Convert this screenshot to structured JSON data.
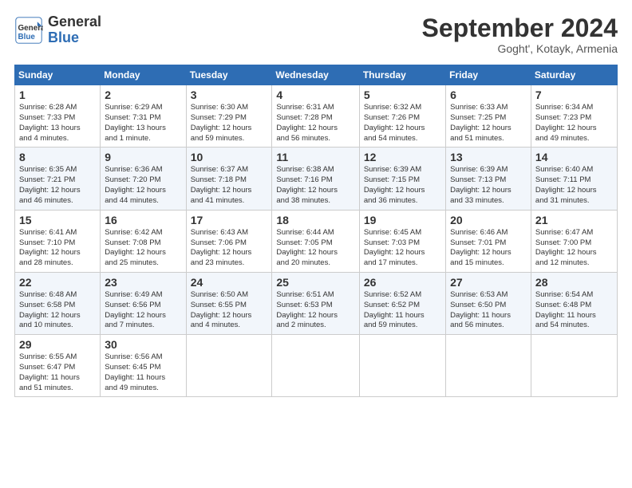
{
  "header": {
    "logo_general": "General",
    "logo_blue": "Blue",
    "month_title": "September 2024",
    "subtitle": "Goght', Kotayk, Armenia"
  },
  "columns": [
    "Sunday",
    "Monday",
    "Tuesday",
    "Wednesday",
    "Thursday",
    "Friday",
    "Saturday"
  ],
  "weeks": [
    [
      {
        "day": "1",
        "info": "Sunrise: 6:28 AM\nSunset: 7:33 PM\nDaylight: 13 hours\nand 4 minutes."
      },
      {
        "day": "2",
        "info": "Sunrise: 6:29 AM\nSunset: 7:31 PM\nDaylight: 13 hours\nand 1 minute."
      },
      {
        "day": "3",
        "info": "Sunrise: 6:30 AM\nSunset: 7:29 PM\nDaylight: 12 hours\nand 59 minutes."
      },
      {
        "day": "4",
        "info": "Sunrise: 6:31 AM\nSunset: 7:28 PM\nDaylight: 12 hours\nand 56 minutes."
      },
      {
        "day": "5",
        "info": "Sunrise: 6:32 AM\nSunset: 7:26 PM\nDaylight: 12 hours\nand 54 minutes."
      },
      {
        "day": "6",
        "info": "Sunrise: 6:33 AM\nSunset: 7:25 PM\nDaylight: 12 hours\nand 51 minutes."
      },
      {
        "day": "7",
        "info": "Sunrise: 6:34 AM\nSunset: 7:23 PM\nDaylight: 12 hours\nand 49 minutes."
      }
    ],
    [
      {
        "day": "8",
        "info": "Sunrise: 6:35 AM\nSunset: 7:21 PM\nDaylight: 12 hours\nand 46 minutes."
      },
      {
        "day": "9",
        "info": "Sunrise: 6:36 AM\nSunset: 7:20 PM\nDaylight: 12 hours\nand 44 minutes."
      },
      {
        "day": "10",
        "info": "Sunrise: 6:37 AM\nSunset: 7:18 PM\nDaylight: 12 hours\nand 41 minutes."
      },
      {
        "day": "11",
        "info": "Sunrise: 6:38 AM\nSunset: 7:16 PM\nDaylight: 12 hours\nand 38 minutes."
      },
      {
        "day": "12",
        "info": "Sunrise: 6:39 AM\nSunset: 7:15 PM\nDaylight: 12 hours\nand 36 minutes."
      },
      {
        "day": "13",
        "info": "Sunrise: 6:39 AM\nSunset: 7:13 PM\nDaylight: 12 hours\nand 33 minutes."
      },
      {
        "day": "14",
        "info": "Sunrise: 6:40 AM\nSunset: 7:11 PM\nDaylight: 12 hours\nand 31 minutes."
      }
    ],
    [
      {
        "day": "15",
        "info": "Sunrise: 6:41 AM\nSunset: 7:10 PM\nDaylight: 12 hours\nand 28 minutes."
      },
      {
        "day": "16",
        "info": "Sunrise: 6:42 AM\nSunset: 7:08 PM\nDaylight: 12 hours\nand 25 minutes."
      },
      {
        "day": "17",
        "info": "Sunrise: 6:43 AM\nSunset: 7:06 PM\nDaylight: 12 hours\nand 23 minutes."
      },
      {
        "day": "18",
        "info": "Sunrise: 6:44 AM\nSunset: 7:05 PM\nDaylight: 12 hours\nand 20 minutes."
      },
      {
        "day": "19",
        "info": "Sunrise: 6:45 AM\nSunset: 7:03 PM\nDaylight: 12 hours\nand 17 minutes."
      },
      {
        "day": "20",
        "info": "Sunrise: 6:46 AM\nSunset: 7:01 PM\nDaylight: 12 hours\nand 15 minutes."
      },
      {
        "day": "21",
        "info": "Sunrise: 6:47 AM\nSunset: 7:00 PM\nDaylight: 12 hours\nand 12 minutes."
      }
    ],
    [
      {
        "day": "22",
        "info": "Sunrise: 6:48 AM\nSunset: 6:58 PM\nDaylight: 12 hours\nand 10 minutes."
      },
      {
        "day": "23",
        "info": "Sunrise: 6:49 AM\nSunset: 6:56 PM\nDaylight: 12 hours\nand 7 minutes."
      },
      {
        "day": "24",
        "info": "Sunrise: 6:50 AM\nSunset: 6:55 PM\nDaylight: 12 hours\nand 4 minutes."
      },
      {
        "day": "25",
        "info": "Sunrise: 6:51 AM\nSunset: 6:53 PM\nDaylight: 12 hours\nand 2 minutes."
      },
      {
        "day": "26",
        "info": "Sunrise: 6:52 AM\nSunset: 6:52 PM\nDaylight: 11 hours\nand 59 minutes."
      },
      {
        "day": "27",
        "info": "Sunrise: 6:53 AM\nSunset: 6:50 PM\nDaylight: 11 hours\nand 56 minutes."
      },
      {
        "day": "28",
        "info": "Sunrise: 6:54 AM\nSunset: 6:48 PM\nDaylight: 11 hours\nand 54 minutes."
      }
    ],
    [
      {
        "day": "29",
        "info": "Sunrise: 6:55 AM\nSunset: 6:47 PM\nDaylight: 11 hours\nand 51 minutes."
      },
      {
        "day": "30",
        "info": "Sunrise: 6:56 AM\nSunset: 6:45 PM\nDaylight: 11 hours\nand 49 minutes."
      },
      {
        "day": "",
        "info": ""
      },
      {
        "day": "",
        "info": ""
      },
      {
        "day": "",
        "info": ""
      },
      {
        "day": "",
        "info": ""
      },
      {
        "day": "",
        "info": ""
      }
    ]
  ]
}
